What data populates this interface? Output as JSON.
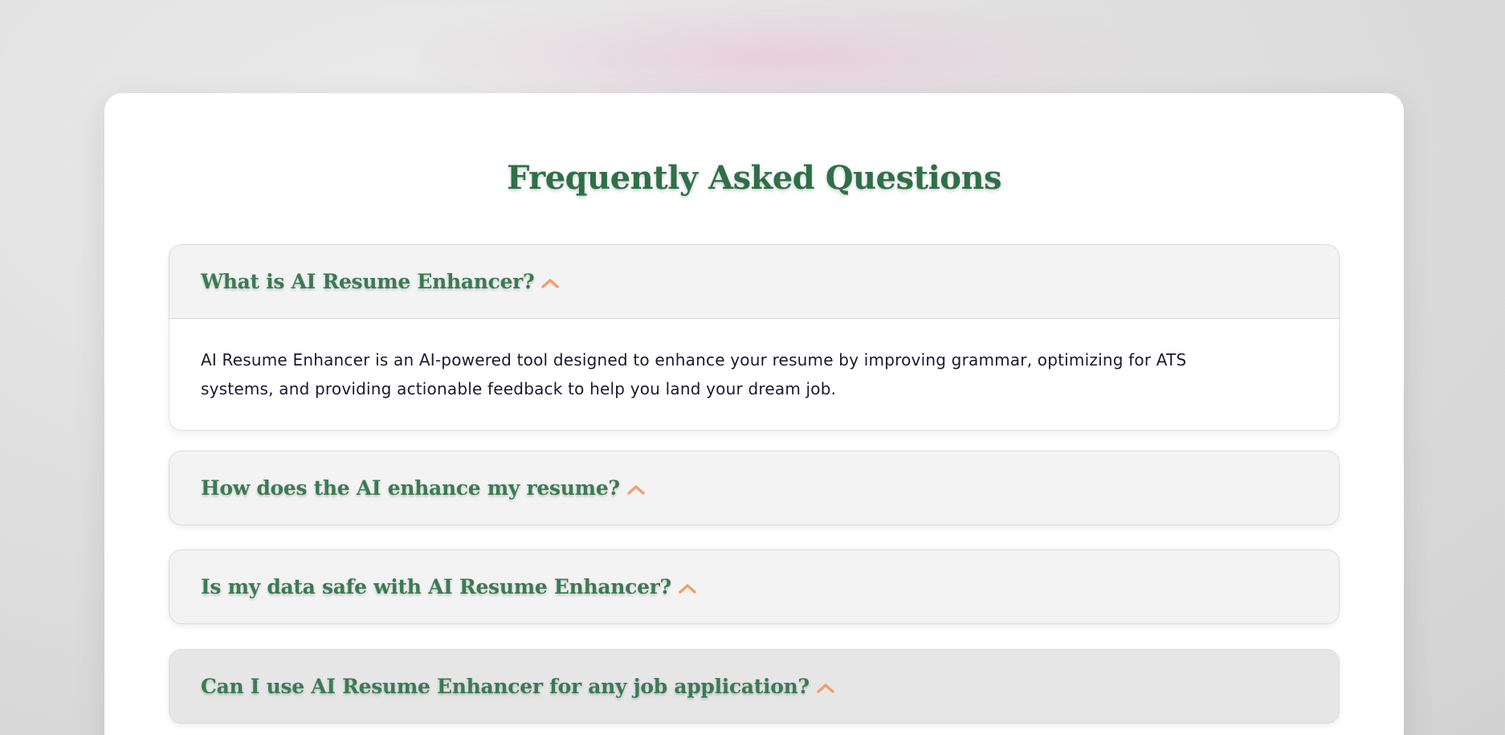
{
  "faq": {
    "title": "Frequently Asked Questions",
    "items": [
      {
        "question": "What is AI Resume Enhancer?",
        "answer": "AI Resume Enhancer is an AI-powered tool designed to enhance your resume by improving grammar, optimizing for ATS systems, and providing actionable feedback to help you land your dream job.",
        "expanded": true
      },
      {
        "question": "How does the AI enhance my resume?",
        "expanded": false
      },
      {
        "question": "Is my data safe with AI Resume Enhancer?",
        "expanded": false
      },
      {
        "question": "Can I use AI Resume Enhancer for any job application?",
        "expanded": false,
        "hovered": true
      }
    ],
    "toggle_icon": "chevron-up-icon"
  },
  "colors": {
    "heading": "#2f6f47",
    "question_text": "#3b7a55",
    "chevron": "#f0a070",
    "question_bg": "#f3f3f3",
    "question_hover_bg": "#e6e6e6",
    "answer_text": "#1a1a2e",
    "card_bg": "#ffffff"
  }
}
